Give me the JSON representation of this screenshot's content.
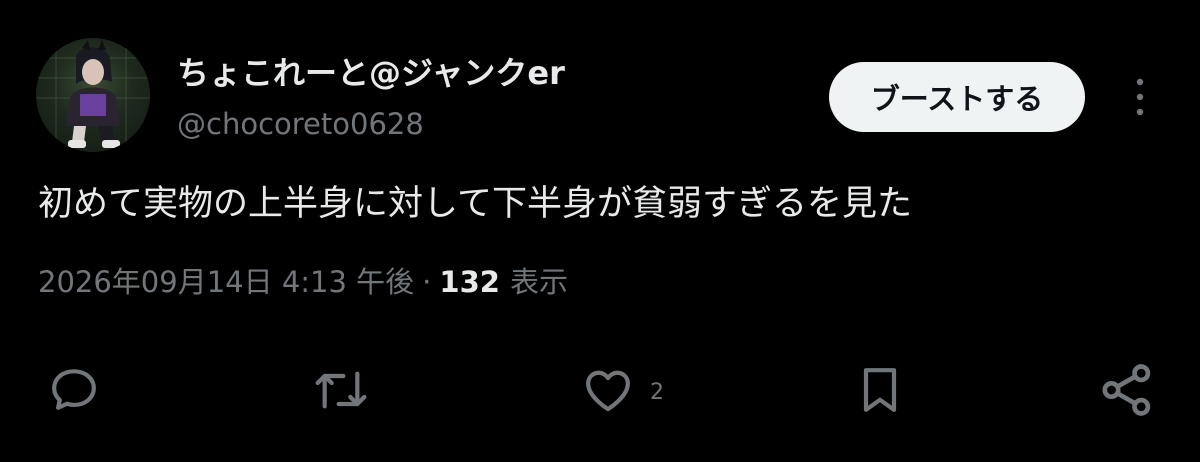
{
  "author": {
    "display_name": "ちょこれーと@ジャンクer",
    "handle": "@chocoreto0628"
  },
  "header": {
    "boost_label": "ブーストする",
    "more_icon": "more-vertical-icon"
  },
  "post": {
    "text": "初めて実物の上半身に対して下半身が貧弱すぎるを見た",
    "timestamp": "2026年09月14日 4:13 午後",
    "separator": "·",
    "views_count": "132",
    "views_label": "表示"
  },
  "actions": {
    "reply_icon": "reply-icon",
    "repost_icon": "repost-icon",
    "like_icon": "heart-icon",
    "like_count": "2",
    "bookmark_icon": "bookmark-icon",
    "share_icon": "share-icon"
  },
  "colors": {
    "background": "#000000",
    "text_primary": "#e7e9ea",
    "text_secondary": "#71767b",
    "button_bg": "#eff3f4",
    "button_text": "#0f1419"
  }
}
